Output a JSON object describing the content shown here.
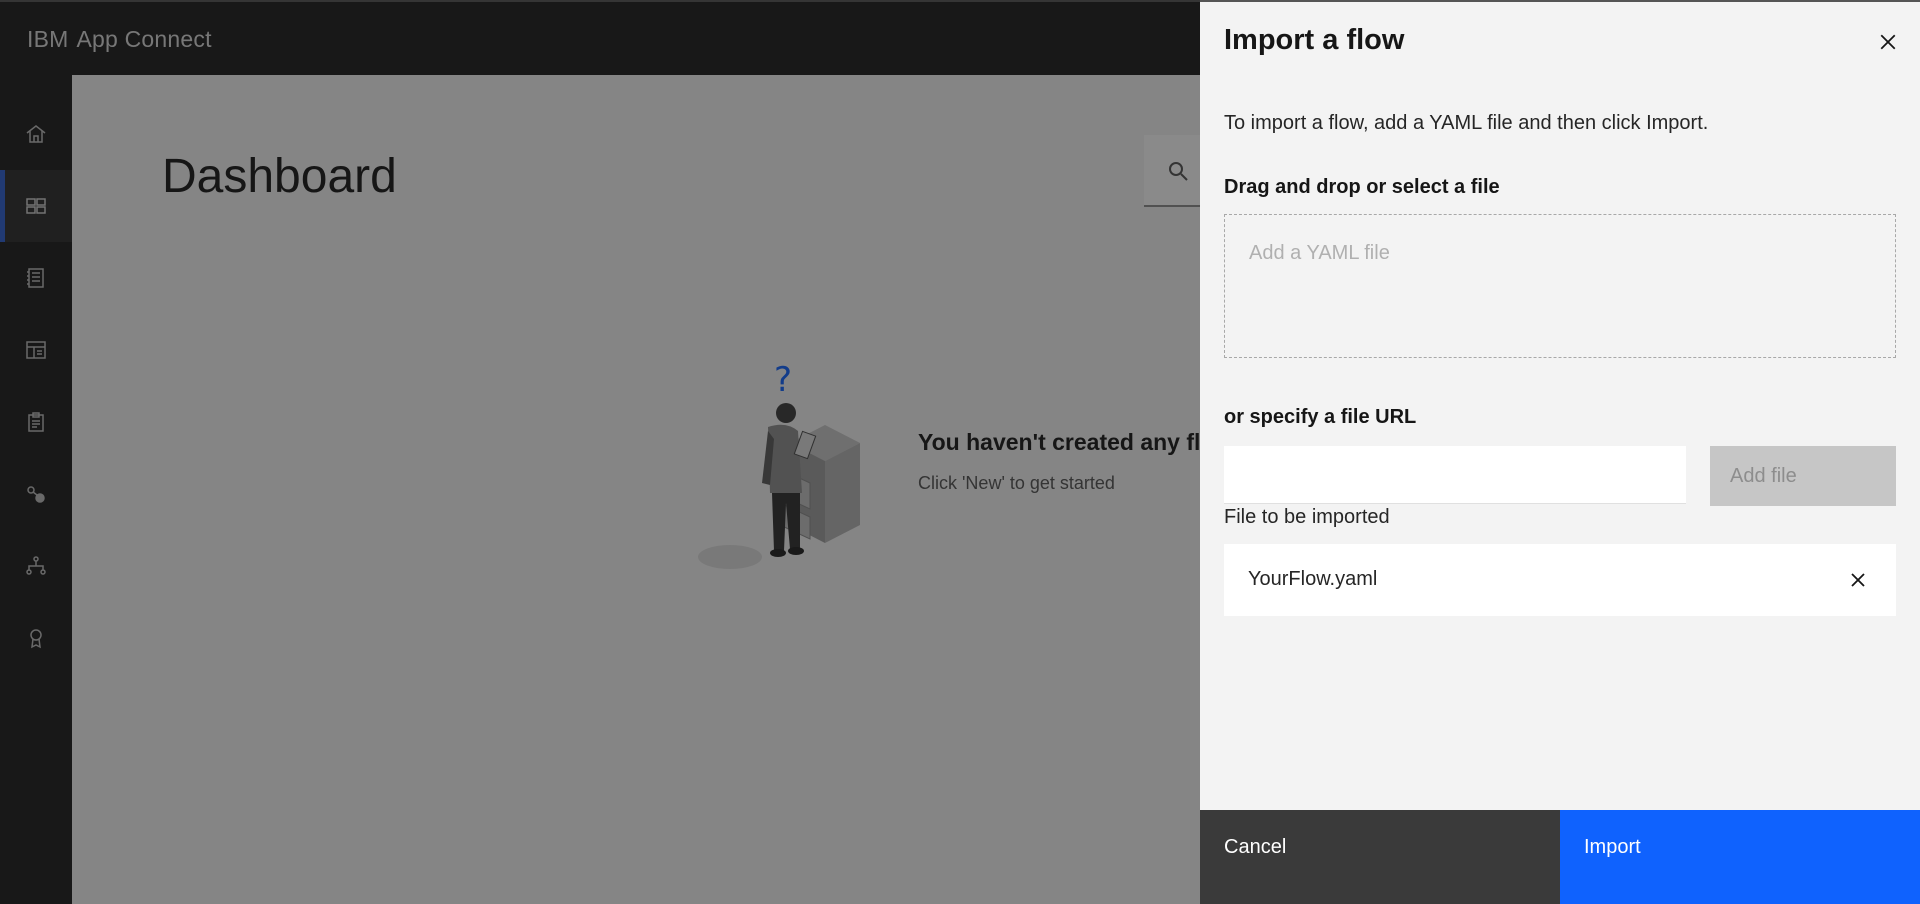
{
  "header": {
    "brand_ibm": "IBM",
    "brand_product": "App Connect"
  },
  "sidebar": {
    "items": [
      {
        "icon": "home-icon",
        "active": false
      },
      {
        "icon": "dashboard-icon",
        "active": true
      },
      {
        "icon": "catalog-icon",
        "active": false
      },
      {
        "icon": "templates-icon",
        "active": false
      },
      {
        "icon": "clipboard-icon",
        "active": false
      },
      {
        "icon": "connections-icon",
        "active": false
      },
      {
        "icon": "hierarchy-icon",
        "active": false
      },
      {
        "icon": "badge-icon",
        "active": false
      }
    ]
  },
  "main": {
    "title": "Dashboard",
    "empty_title": "You haven't created any fl",
    "empty_subtitle": "Click 'New' to get started",
    "illustration_mark": "?"
  },
  "panel": {
    "title": "Import a flow",
    "intro": "To import a flow, add a YAML file and then click Import.",
    "drop_label": "Drag and drop or select a file",
    "drop_placeholder": "Add a YAML file",
    "url_label": "or specify a file URL",
    "url_value": "",
    "add_file_label": "Add file",
    "imported_label": "File to be imported",
    "file_name": "YourFlow.yaml",
    "cancel_label": "Cancel",
    "import_label": "Import"
  },
  "colors": {
    "primary": "#0f62fe",
    "active_nav": "#2d5fd0",
    "header_bg": "#1b1b1b",
    "panel_bg": "#f3f3f3"
  }
}
